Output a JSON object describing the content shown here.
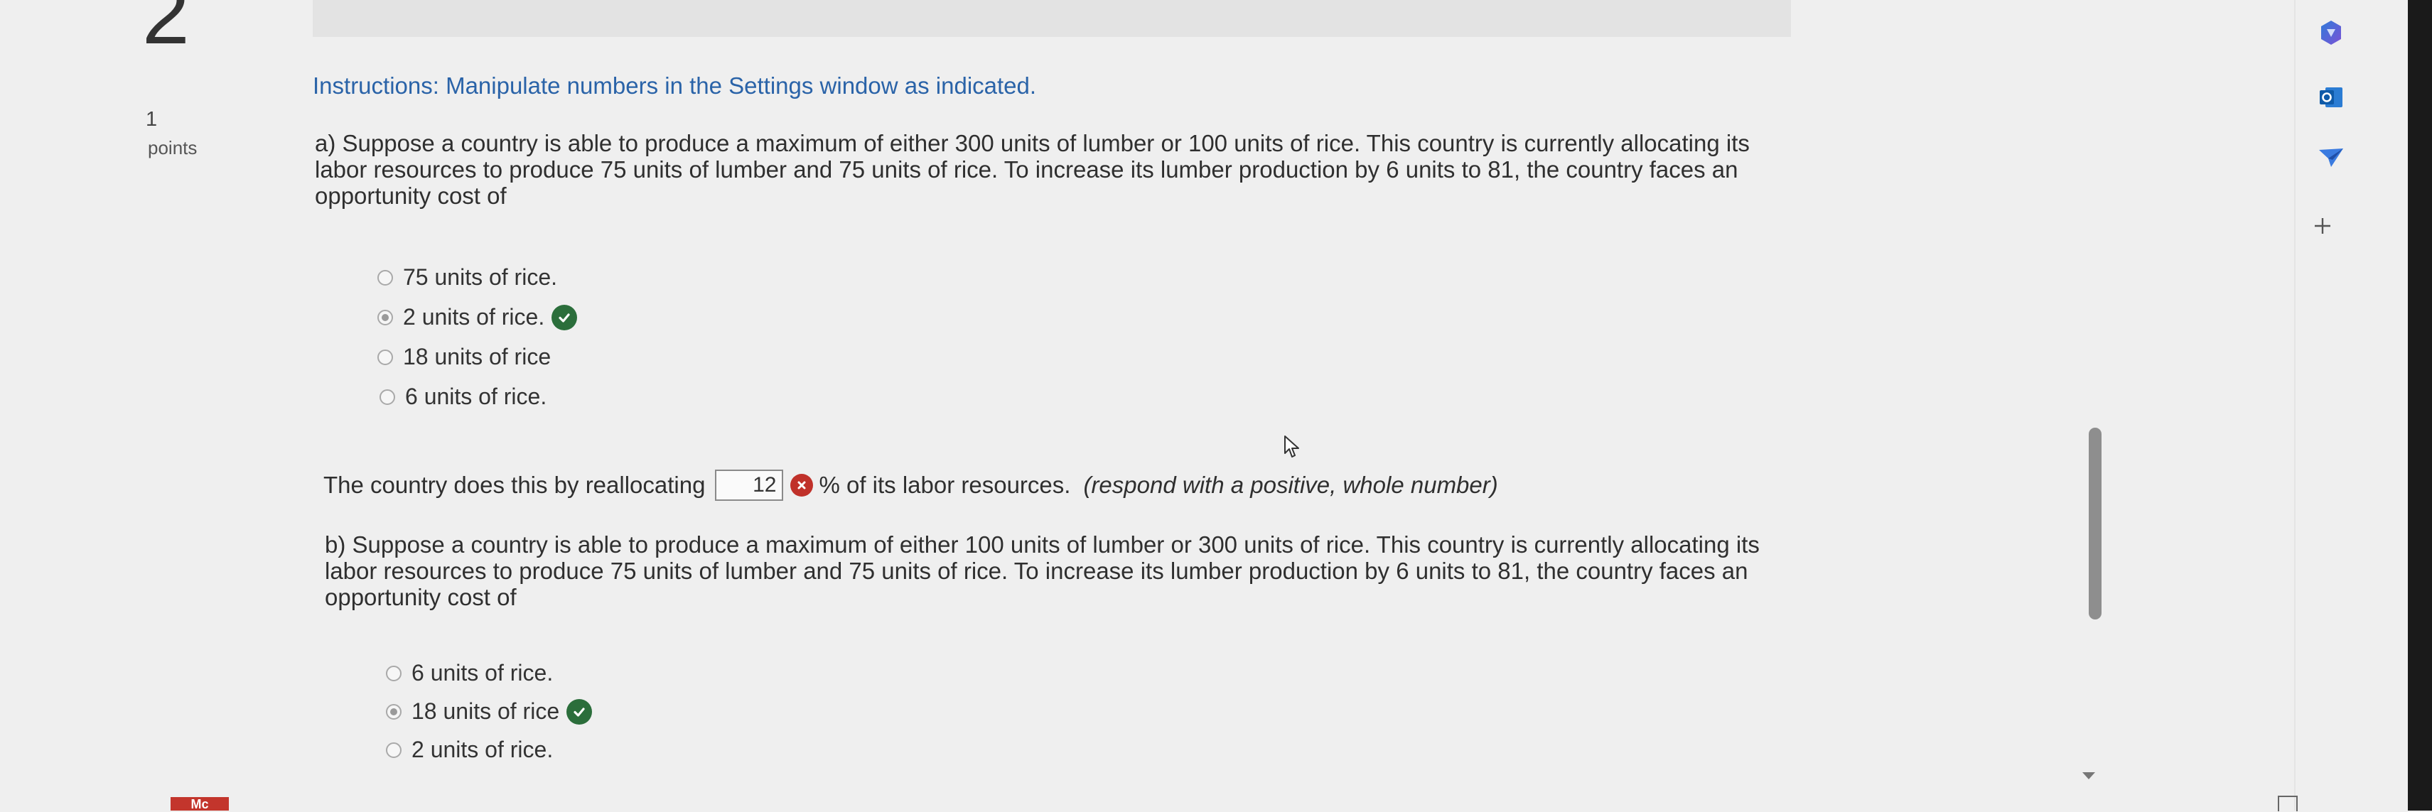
{
  "question": {
    "number": "2",
    "points_value": "1",
    "points_label": "points",
    "instructions": "Instructions: Manipulate numbers in the Settings window as indicated."
  },
  "part_a": {
    "text": "a) Suppose a country is able to produce a maximum of either 300 units of lumber or 100 units of rice.  This country is currently allocating its labor resources to produce 75 units of lumber and 75 units of rice.  To increase its lumber production by 6 units to 81, the country faces an opportunity cost of",
    "options": [
      {
        "label": "75 units of rice.",
        "selected": false,
        "correct": false
      },
      {
        "label": "2 units of rice.",
        "selected": true,
        "correct": true
      },
      {
        "label": "18 units of rice",
        "selected": false,
        "correct": false
      },
      {
        "label": "6 units of rice.",
        "selected": false,
        "correct": false
      }
    ],
    "followup": {
      "prefix": "The country does this by reallocating",
      "input_value": "12",
      "input_correct": false,
      "suffix": "% of its labor resources.",
      "hint": "(respond with a positive, whole number)"
    }
  },
  "part_b": {
    "text": "b) Suppose a country is able to produce a maximum of either 100 units of lumber or 300 units of rice.  This country is currently allocating its labor resources to produce 75 units of lumber and 75 units of rice.  To increase its lumber production by 6 units to 81, the country faces an opportunity cost of",
    "options": [
      {
        "label": "6 units of rice.",
        "selected": false,
        "correct": false
      },
      {
        "label": "18 units of rice",
        "selected": true,
        "correct": true
      },
      {
        "label": "2 units of rice.",
        "selected": false,
        "correct": false
      }
    ]
  },
  "bottom_tab_label": "Mc",
  "sidebar_icons": [
    "copilot-icon",
    "outlook-icon",
    "send-icon",
    "add-icon"
  ],
  "colors": {
    "instructions": "#2a63a8",
    "correct": "#2b6e3b",
    "incorrect": "#c0312a",
    "tab": "#c3352c"
  }
}
